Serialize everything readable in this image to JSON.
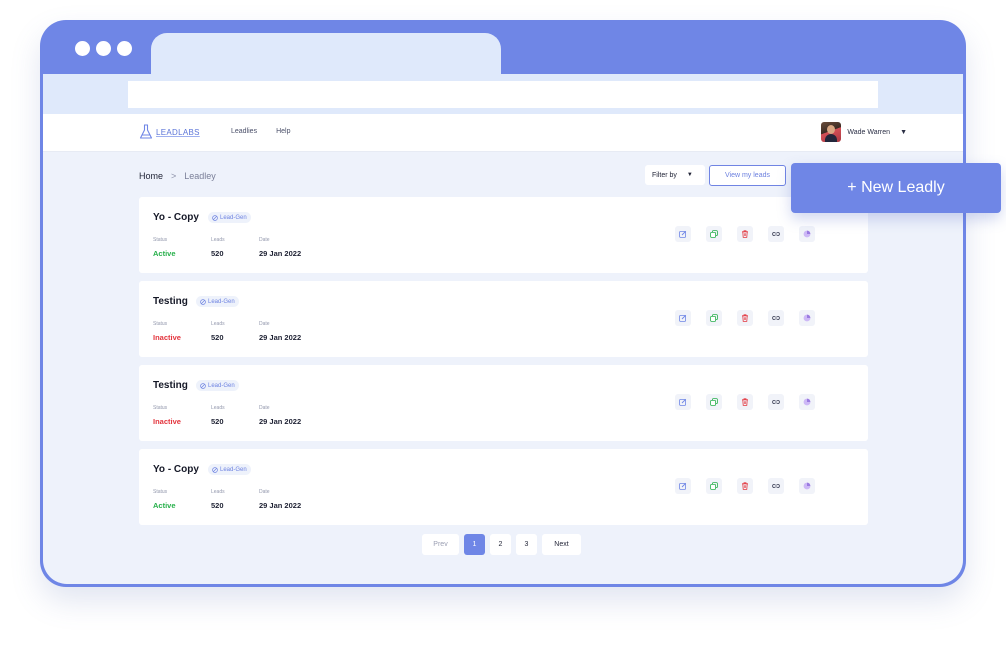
{
  "app": {
    "name": "LEADLABS"
  },
  "nav": {
    "items": [
      "Leadlies",
      "Help"
    ]
  },
  "user": {
    "name": "Wade Warren"
  },
  "breadcrumb": {
    "home": "Home",
    "separator": ">",
    "current": "Leadley"
  },
  "toolbar": {
    "filter_label": "Filter by",
    "view_leads_label": "View my leads",
    "new_leadly_label": "+ New Leadly"
  },
  "labels": {
    "status": "Status",
    "leads": "Leads",
    "date": "Date",
    "badge": "Lead-Gen"
  },
  "cards": [
    {
      "title": "Yo - Copy",
      "status": "Active",
      "leads": "520",
      "date": "29 Jan 2022"
    },
    {
      "title": "Testing",
      "status": "Inactive",
      "leads": "520",
      "date": "29 Jan 2022"
    },
    {
      "title": "Testing",
      "status": "Inactive",
      "leads": "520",
      "date": "29 Jan 2022"
    },
    {
      "title": "Yo - Copy",
      "status": "Active",
      "leads": "520",
      "date": "29 Jan 2022"
    }
  ],
  "pagination": {
    "prev": "Prev",
    "pages": [
      "1",
      "2",
      "3"
    ],
    "next": "Next",
    "current": "1"
  },
  "colors": {
    "brand": "#6f86e6",
    "active": "#27b04b",
    "inactive": "#e3343d",
    "edit": "#6f86e6",
    "duplicate": "#27b04b",
    "delete": "#e3343d",
    "link": "#3b3f55",
    "stats": "#9b7be0"
  },
  "icons": {
    "action_icons": [
      "edit-icon",
      "duplicate-icon",
      "delete-icon",
      "link-icon",
      "pie-chart-icon"
    ]
  }
}
